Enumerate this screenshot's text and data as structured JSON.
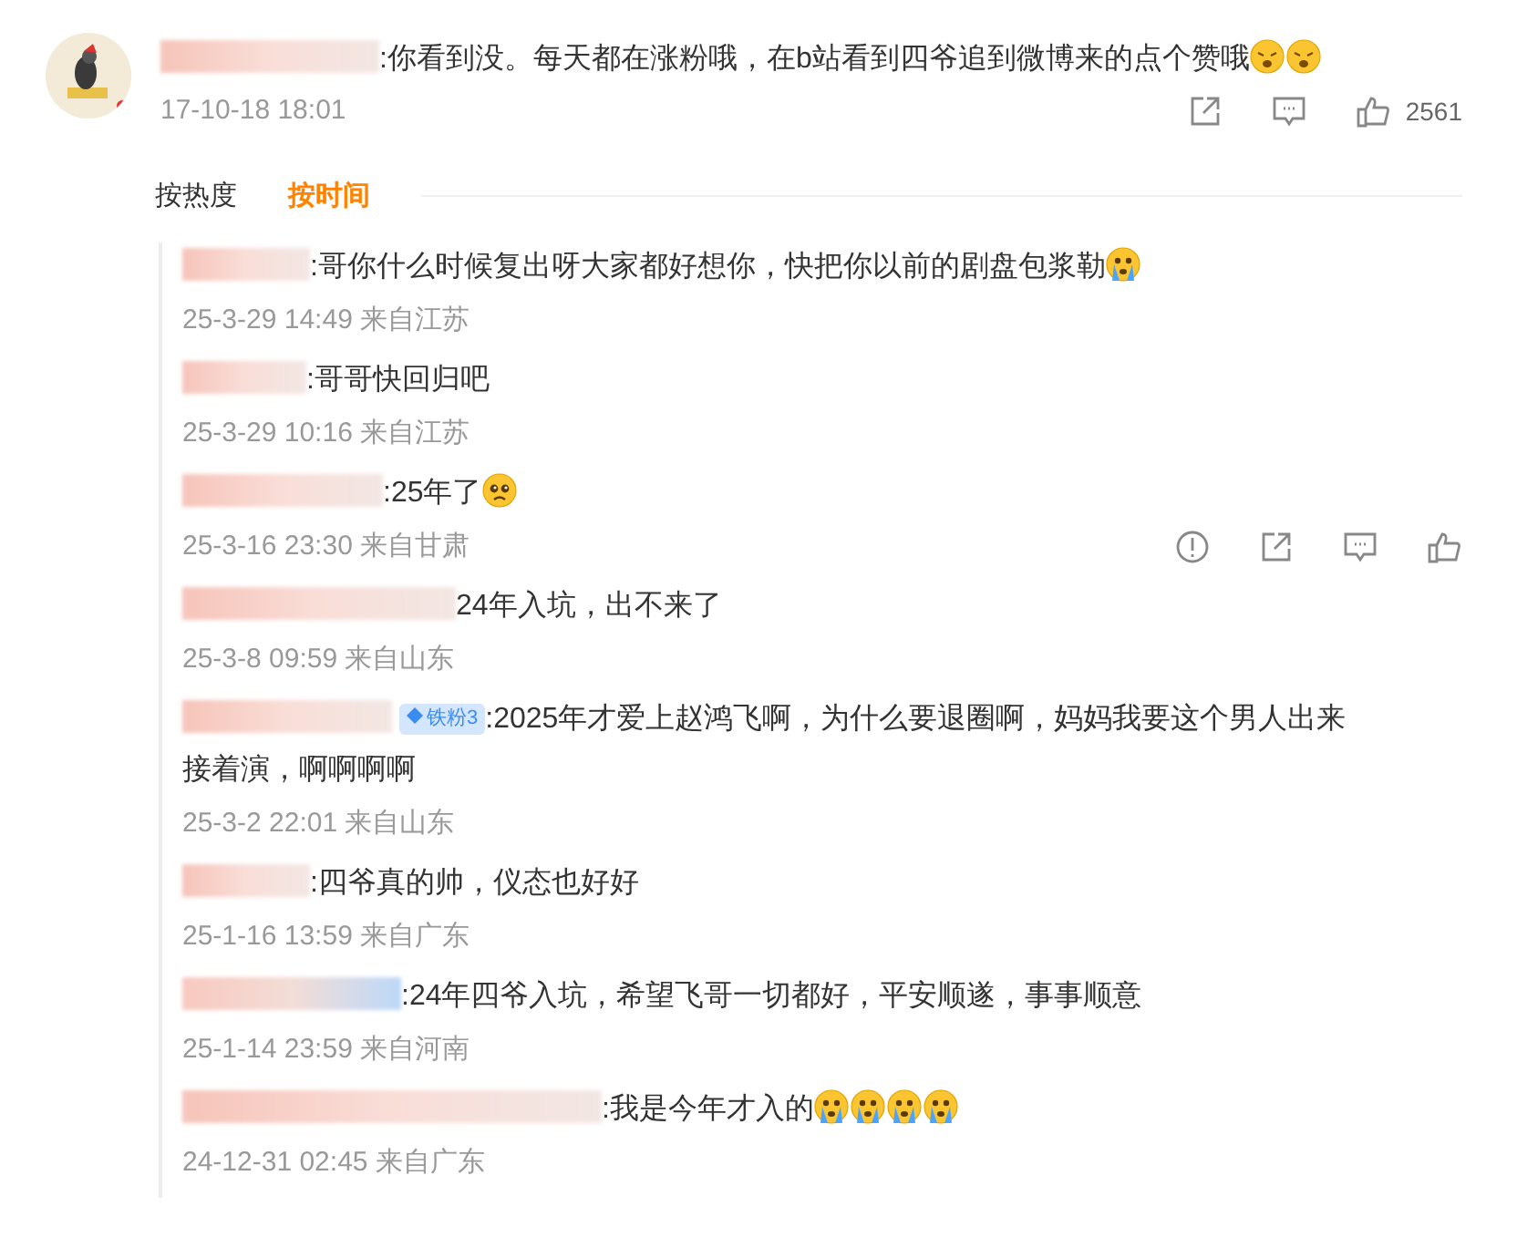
{
  "comment": {
    "text": ":你看到没。每天都在涨粉哦，在b站看到四爷追到微博来的点个赞哦",
    "emojis": [
      {
        "kind": "weary"
      },
      {
        "kind": "weary"
      }
    ],
    "time": "17-10-18 18:01",
    "likes": "2561"
  },
  "sort_tabs": [
    {
      "label": "按热度",
      "selected": false
    },
    {
      "label": "按时间",
      "selected": true
    }
  ],
  "replies": [
    {
      "text": ":哥你什么时候复出呀大家都好想你，快把你以前的剧盘包浆勒",
      "emojis": [
        {
          "kind": "crying"
        }
      ],
      "time": "25-3-29 14:49 来自江苏",
      "hovered": false
    },
    {
      "text": ":哥哥快回归吧",
      "time": "25-3-29 10:16 来自江苏",
      "hovered": false
    },
    {
      "text": ":25年了",
      "emojis": [
        {
          "kind": "teary"
        }
      ],
      "time": "25-3-16 23:30 来自甘肃",
      "hovered": true
    },
    {
      "text": "24年入坑，出不来了",
      "time": "25-3-8 09:59 来自山东",
      "hovered": false
    },
    {
      "badge": "铁粉3",
      "text": ":2025年才爱上赵鸿飞啊，为什么要退圈啊，妈妈我要这个男人出来接着演，啊啊啊啊",
      "time": "25-3-2 22:01 来自山东",
      "hovered": false
    },
    {
      "text": ":四爷真的帅，仪态也好好",
      "time": "25-1-16 13:59 来自广东",
      "hovered": false
    },
    {
      "text": ":24年四爷入坑，希望飞哥一切都好，平安顺遂，事事顺意",
      "time": "25-1-14 23:59 来自河南",
      "hovered": false
    },
    {
      "text": ":我是今年才入的",
      "emojis": [
        {
          "kind": "crying"
        },
        {
          "kind": "crying"
        },
        {
          "kind": "crying"
        },
        {
          "kind": "crying"
        }
      ],
      "time": "24-12-31 02:45 来自广东",
      "hovered": false
    }
  ]
}
